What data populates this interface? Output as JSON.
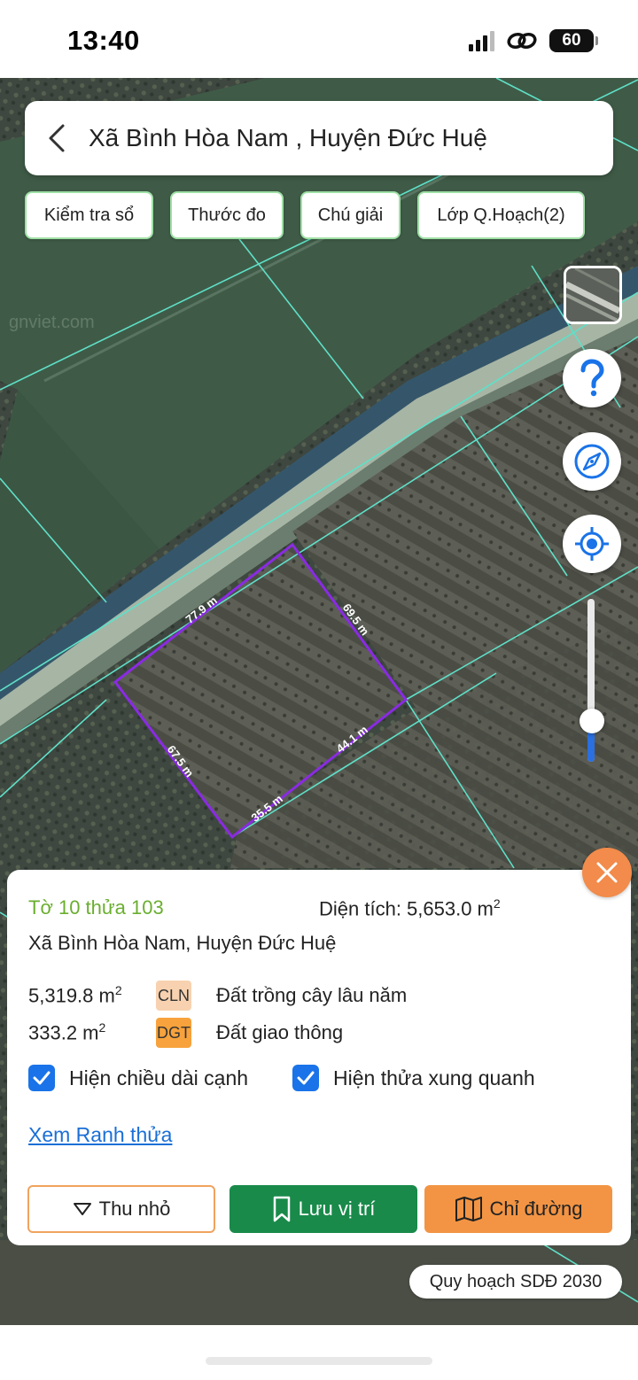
{
  "status_bar": {
    "time": "13:40",
    "battery": "60"
  },
  "top_bar": {
    "title": "Xã Bình Hòa Nam , Huyện Đức Huệ"
  },
  "chips": [
    {
      "label": "Kiểm tra sổ"
    },
    {
      "label": "Thước đo"
    },
    {
      "label": "Chú giải"
    },
    {
      "label": "Lớp Q.Hoạch(2)"
    }
  ],
  "map": {
    "watermark": "gnviet.com",
    "edge_labels": [
      "77.9 m",
      "69.5 m",
      "67.5 m",
      "44.1 m",
      "35.5 m"
    ],
    "parcel_outline_color": "#8a2be2",
    "boundary_line_color": "#5fe0c8"
  },
  "zoom_slider": {
    "level_fraction": 0.25
  },
  "info_panel": {
    "parcel_id": "Tờ 10 thửa 103",
    "area_label": "Diện tích: 5,653.0 m",
    "area_unit_sup": "2",
    "address": "Xã Bình Hòa Nam, Huyện Đức Huệ",
    "land_uses": [
      {
        "area": "5,319.8 m",
        "sup": "2",
        "code": "CLN",
        "name": "Đất trồng cây lâu năm",
        "color": "#f8d2b0"
      },
      {
        "area": "333.2 m",
        "sup": "2",
        "code": "DGT",
        "name": "Đất giao thông",
        "color": "#f7a23c"
      }
    ],
    "checkbox_edges": {
      "label": "Hiện chiều dài cạnh",
      "checked": true
    },
    "checkbox_neighbors": {
      "label": "Hiện thửa xung quanh",
      "checked": true
    },
    "link": "Xem Ranh thửa",
    "buttons": {
      "shrink": "Thu nhỏ",
      "save": "Lưu vị trí",
      "directions": "Chỉ đường"
    },
    "accent_green": "#198a4a",
    "accent_orange": "#f29444"
  },
  "plan_badge": "Quy hoạch SDĐ 2030"
}
